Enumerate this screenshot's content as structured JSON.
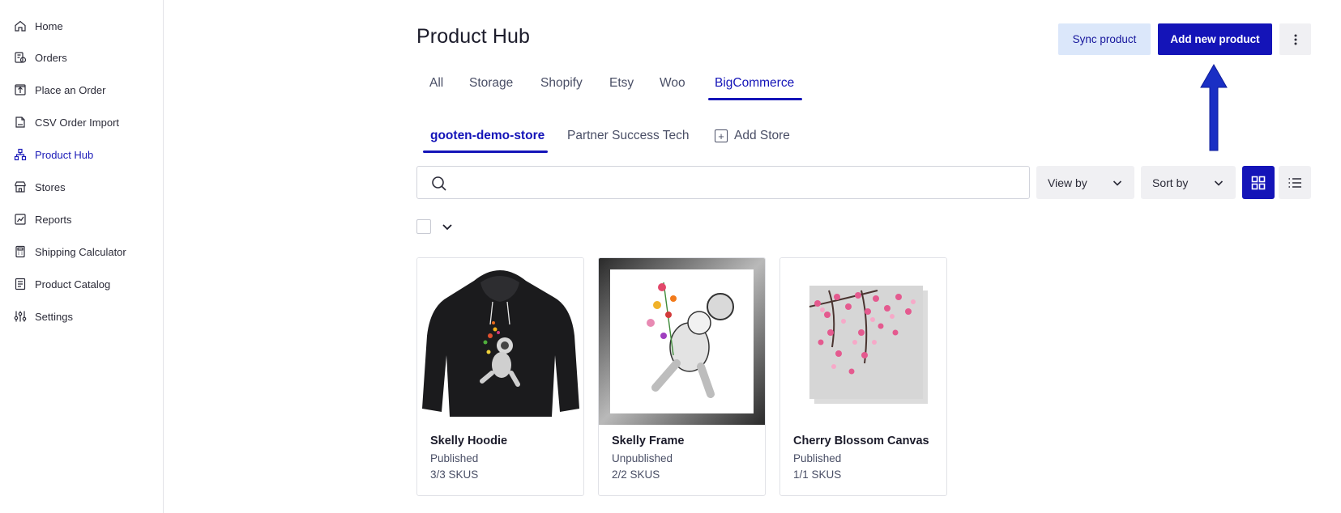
{
  "sidebar": {
    "items": [
      {
        "label": "Home",
        "icon": "home-icon"
      },
      {
        "label": "Orders",
        "icon": "orders-icon"
      },
      {
        "label": "Place an Order",
        "icon": "place-order-icon"
      },
      {
        "label": "CSV Order Import",
        "icon": "csv-icon"
      },
      {
        "label": "Product Hub",
        "icon": "product-hub-icon",
        "active": true
      },
      {
        "label": "Stores",
        "icon": "store-icon"
      },
      {
        "label": "Reports",
        "icon": "reports-icon"
      },
      {
        "label": "Shipping Calculator",
        "icon": "calculator-icon"
      },
      {
        "label": "Product Catalog",
        "icon": "catalog-icon"
      },
      {
        "label": "Settings",
        "icon": "settings-icon"
      }
    ]
  },
  "header": {
    "title": "Product Hub",
    "sync_label": "Sync product",
    "add_label": "Add new product",
    "more_icon": "more-vertical-icon"
  },
  "tabs": [
    {
      "label": "All"
    },
    {
      "label": "Storage"
    },
    {
      "label": "Shopify"
    },
    {
      "label": "Etsy"
    },
    {
      "label": "Woo"
    },
    {
      "label": "BigCommerce",
      "active": true
    }
  ],
  "store_tabs": [
    {
      "label": "gooten-demo-store",
      "active": true
    },
    {
      "label": "Partner Success Tech"
    }
  ],
  "add_store_label": "Add Store",
  "search": {
    "placeholder": "",
    "value": ""
  },
  "view_by_label": "View by",
  "sort_by_label": "Sort by",
  "products": [
    {
      "name": "Skelly Hoodie",
      "status": "Published",
      "skus": "3/3 SKUS"
    },
    {
      "name": "Skelly Frame",
      "status": "Unpublished",
      "skus": "2/2 SKUS"
    },
    {
      "name": "Cherry Blossom Canvas",
      "status": "Published",
      "skus": "1/1 SKUS"
    }
  ],
  "colors": {
    "accent": "#1414b8",
    "sync_bg": "#dbe7fa",
    "annotation_arrow": "#1a2fc4"
  }
}
